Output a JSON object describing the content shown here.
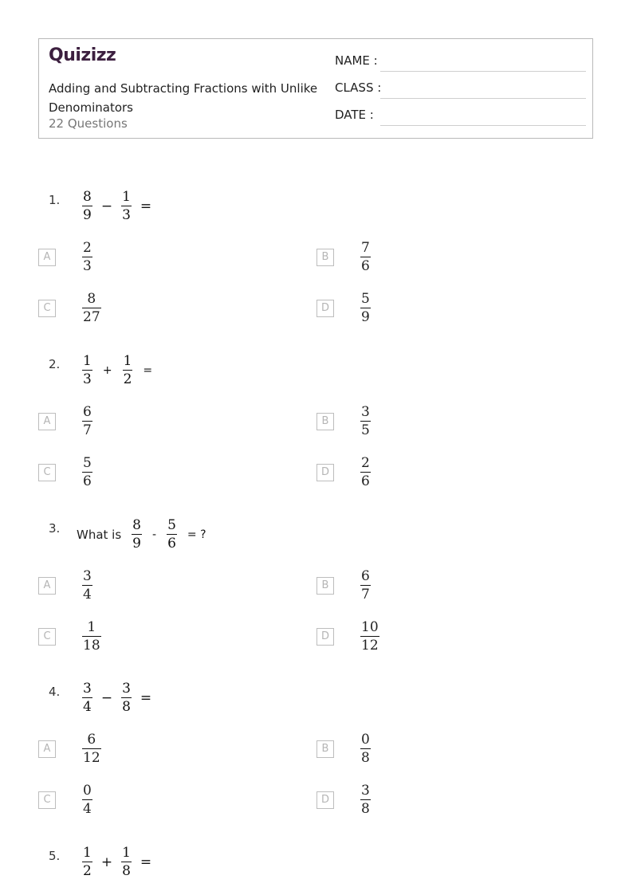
{
  "header": {
    "logo": "Quizizz",
    "title": "Adding and Subtracting Fractions with Unlike Denominators",
    "question_count": "22 Questions",
    "fields": [
      {
        "label": "NAME :"
      },
      {
        "label": "CLASS :"
      },
      {
        "label": "DATE  :"
      }
    ]
  },
  "questions": [
    {
      "number": "1.",
      "prefix": "",
      "expression": [
        {
          "n": "8",
          "d": "9"
        },
        {
          "op": "−"
        },
        {
          "n": "1",
          "d": "3"
        },
        {
          "op": "="
        }
      ],
      "choices": [
        {
          "letter": "A",
          "n": "2",
          "d": "3"
        },
        {
          "letter": "B",
          "n": "7",
          "d": "6"
        },
        {
          "letter": "C",
          "n": "8",
          "d": "27"
        },
        {
          "letter": "D",
          "n": "5",
          "d": "9"
        }
      ]
    },
    {
      "number": "2.",
      "prefix": "",
      "expression": [
        {
          "n": "1",
          "d": "3"
        },
        {
          "op": "+"
        },
        {
          "n": "1",
          "d": "2"
        },
        {
          "op": "="
        }
      ],
      "choices": [
        {
          "letter": "A",
          "n": "6",
          "d": "7"
        },
        {
          "letter": "B",
          "n": "3",
          "d": "5"
        },
        {
          "letter": "C",
          "n": "5",
          "d": "6"
        },
        {
          "letter": "D",
          "n": "2",
          "d": "6"
        }
      ]
    },
    {
      "number": "3.",
      "prefix": "What is",
      "expression": [
        {
          "n": "8",
          "d": "9"
        },
        {
          "op": "-"
        },
        {
          "n": "5",
          "d": "6"
        },
        {
          "op": "= ?"
        }
      ],
      "choices": [
        {
          "letter": "A",
          "n": "3",
          "d": "4"
        },
        {
          "letter": "B",
          "n": "6",
          "d": "7"
        },
        {
          "letter": "C",
          "n": "1",
          "d": "18"
        },
        {
          "letter": "D",
          "n": "10",
          "d": "12"
        }
      ]
    },
    {
      "number": "4.",
      "prefix": "",
      "expression": [
        {
          "n": "3",
          "d": "4"
        },
        {
          "op": "−"
        },
        {
          "n": "3",
          "d": "8"
        },
        {
          "op": "="
        }
      ],
      "choices": [
        {
          "letter": "A",
          "n": "6",
          "d": "12"
        },
        {
          "letter": "B",
          "n": "0",
          "d": "8"
        },
        {
          "letter": "C",
          "n": "0",
          "d": "4"
        },
        {
          "letter": "D",
          "n": "3",
          "d": "8"
        }
      ]
    },
    {
      "number": "5.",
      "prefix": "",
      "expression": [
        {
          "n": "1",
          "d": "2"
        },
        {
          "op": "+"
        },
        {
          "n": "1",
          "d": "8"
        },
        {
          "op": "="
        }
      ],
      "choices": []
    }
  ]
}
